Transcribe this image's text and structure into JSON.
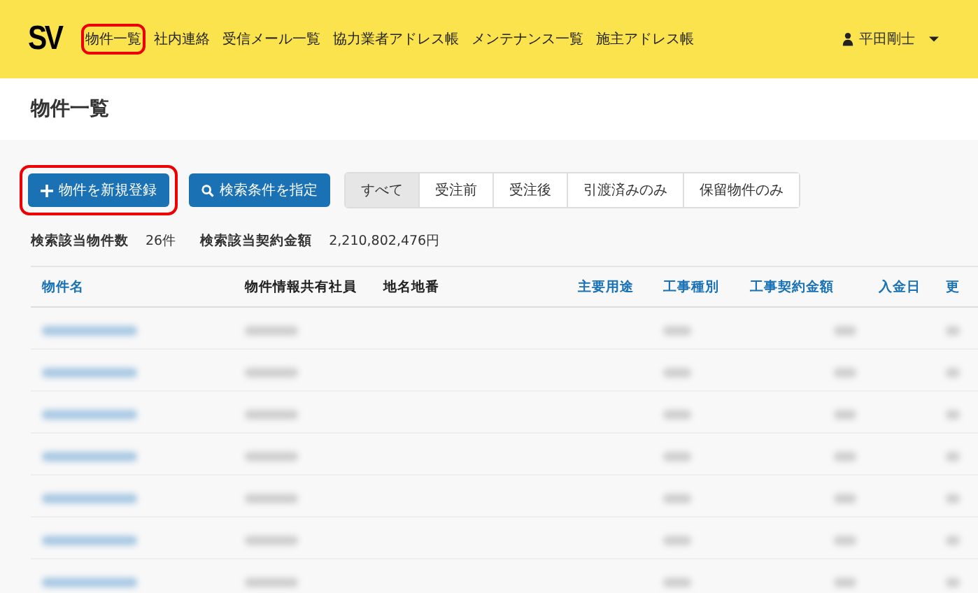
{
  "navbar": {
    "logo": "SV",
    "items": [
      {
        "label": "物件一覧",
        "highlighted": true
      },
      {
        "label": "社内連絡",
        "highlighted": false
      },
      {
        "label": "受信メール一覧",
        "highlighted": false
      },
      {
        "label": "協力業者アドレス帳",
        "highlighted": false
      },
      {
        "label": "メンテナンス一覧",
        "highlighted": false
      },
      {
        "label": "施主アドレス帳",
        "highlighted": false
      }
    ],
    "user": "平田剛士"
  },
  "page_title": "物件一覧",
  "actions": [
    {
      "label": "物件を新規登録",
      "kind": "add",
      "highlighted": true
    },
    {
      "label": "検索条件を指定",
      "kind": "search",
      "highlighted": false
    }
  ],
  "filters": [
    {
      "label": "すべて",
      "selected": true
    },
    {
      "label": "受注前",
      "selected": false
    },
    {
      "label": "受注後",
      "selected": false
    },
    {
      "label": "引渡済みのみ",
      "selected": false
    },
    {
      "label": "保留物件のみ",
      "selected": false
    }
  ],
  "summary": [
    {
      "label": "検索該当物件数",
      "value": "26件"
    },
    {
      "label": "検索該当契約金額",
      "value": "2,210,802,476円"
    }
  ],
  "table": {
    "columns": [
      {
        "label": "物件名",
        "sortable": true
      },
      {
        "label": "物件情報共有社員",
        "sortable": false
      },
      {
        "label": "地名地番",
        "sortable": false
      },
      {
        "label": "主要用途",
        "sortable": true
      },
      {
        "label": "工事種別",
        "sortable": true
      },
      {
        "label": "工事契約金額",
        "sortable": true
      },
      {
        "label": "入金日",
        "sortable": true
      },
      {
        "label": "更",
        "sortable": true
      }
    ],
    "rows": [
      {
        "cells": [
          {
            "kind": "link"
          },
          {
            "kind": "text"
          },
          {
            "kind": "blank"
          },
          {
            "kind": "blank"
          },
          {
            "kind": "text"
          },
          {
            "kind": "text"
          },
          {
            "kind": "blank"
          },
          {
            "kind": "text"
          }
        ]
      },
      {
        "cells": [
          {
            "kind": "link"
          },
          {
            "kind": "text"
          },
          {
            "kind": "blank"
          },
          {
            "kind": "blank"
          },
          {
            "kind": "text"
          },
          {
            "kind": "text"
          },
          {
            "kind": "blank"
          },
          {
            "kind": "text"
          }
        ]
      },
      {
        "cells": [
          {
            "kind": "link"
          },
          {
            "kind": "text"
          },
          {
            "kind": "blank"
          },
          {
            "kind": "blank"
          },
          {
            "kind": "text"
          },
          {
            "kind": "text"
          },
          {
            "kind": "blank"
          },
          {
            "kind": "text"
          }
        ]
      },
      {
        "cells": [
          {
            "kind": "link"
          },
          {
            "kind": "text"
          },
          {
            "kind": "blank"
          },
          {
            "kind": "blank"
          },
          {
            "kind": "text"
          },
          {
            "kind": "text"
          },
          {
            "kind": "blank"
          },
          {
            "kind": "text"
          }
        ]
      },
      {
        "cells": [
          {
            "kind": "link"
          },
          {
            "kind": "text"
          },
          {
            "kind": "blank"
          },
          {
            "kind": "blank"
          },
          {
            "kind": "text"
          },
          {
            "kind": "text"
          },
          {
            "kind": "blank"
          },
          {
            "kind": "text"
          }
        ]
      },
      {
        "cells": [
          {
            "kind": "link"
          },
          {
            "kind": "text"
          },
          {
            "kind": "blank"
          },
          {
            "kind": "blank"
          },
          {
            "kind": "text"
          },
          {
            "kind": "text"
          },
          {
            "kind": "blank"
          },
          {
            "kind": "text"
          }
        ]
      },
      {
        "cells": [
          {
            "kind": "link"
          },
          {
            "kind": "text"
          },
          {
            "kind": "blank"
          },
          {
            "kind": "blank"
          },
          {
            "kind": "text"
          },
          {
            "kind": "text"
          },
          {
            "kind": "blank"
          },
          {
            "kind": "text"
          }
        ]
      }
    ]
  }
}
